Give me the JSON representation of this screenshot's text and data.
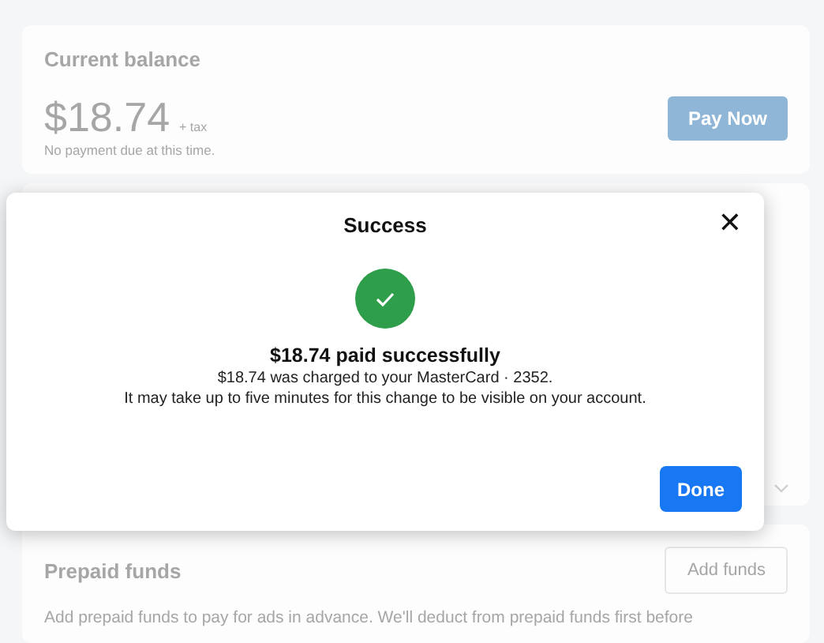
{
  "balance_card": {
    "title": "Current balance",
    "amount": "$18.74",
    "tax_note": "+ tax",
    "note": "No payment due at this time.",
    "button": "Pay Now"
  },
  "prepaid_card": {
    "title": "Prepaid funds",
    "button": "Add funds",
    "description": "Add prepaid funds to pay for ads in advance. We'll deduct from prepaid funds first before"
  },
  "dialog": {
    "title": "Success",
    "close": "✕",
    "heading": "$18.74 paid successfully",
    "lines": [
      "$18.74 was charged to your MasterCard · 2352.",
      "It may take up to five minutes for this change to be visible on your account."
    ],
    "button": "Done"
  }
}
